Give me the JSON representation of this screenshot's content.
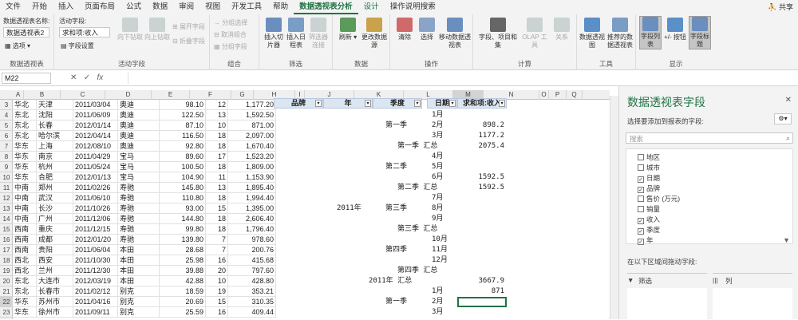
{
  "tabs": [
    "文件",
    "开始",
    "插入",
    "页面布局",
    "公式",
    "数据",
    "审阅",
    "视图",
    "开发工具",
    "帮助",
    "数据透视表分析",
    "设计"
  ],
  "tell_me": "操作说明搜索",
  "share": "共享",
  "ribbon": {
    "pivot_name_label": "数据透视表名称:",
    "pivot_name": "数据透视表2",
    "options": "选项",
    "active_field_label": "活动字段:",
    "active_field": "求和项:收入",
    "field_settings": "字段设置",
    "drill_down": "向下钻取",
    "drill_up": "向上钻取",
    "expand": "展开字段",
    "collapse": "折叠字段",
    "group_sel": "分组选择",
    "ungroup": "取消组合",
    "group_field": "分组字段",
    "insert_slicer": "插入切片器",
    "insert_timeline": "插入日程表",
    "filter_conn": "筛选器连接",
    "refresh": "刷新",
    "change_source": "更改数据源",
    "clear": "清除",
    "select": "选择",
    "move": "移动数据透视表",
    "fields_items": "字段、项目和集",
    "olap": "OLAP 工具",
    "relationships": "关系",
    "pivot_chart": "数据透视图",
    "recommended": "推荐的数据透视表",
    "field_list": "字段列表",
    "pm_buttons": "+/- 按钮",
    "field_headers": "字段标题",
    "groups": [
      "数据透视表",
      "活动字段",
      "组合",
      "筛选",
      "数据",
      "操作",
      "计算",
      "工具",
      "显示"
    ]
  },
  "name_box": "M22",
  "fx": "fx",
  "columns": [
    "A",
    "B",
    "C",
    "D",
    "E",
    "F",
    "G",
    "H",
    "I",
    "J",
    "K",
    "L",
    "M",
    "N",
    "O",
    "P",
    "Q"
  ],
  "rows": [
    {
      "n": "3",
      "a": "华北",
      "b": "天津",
      "c": "2011/03/04",
      "d": "奥迪",
      "e": "98.10",
      "f": "12",
      "g": "1,177.20"
    },
    {
      "n": "4",
      "a": "东北",
      "b": "沈阳",
      "c": "2011/06/09",
      "d": "奥迪",
      "e": "122.50",
      "f": "13",
      "g": "1,592.50"
    },
    {
      "n": "5",
      "a": "东北",
      "b": "长春",
      "c": "2012/01/14",
      "d": "奥迪",
      "e": "87.10",
      "f": "10",
      "g": "871.00"
    },
    {
      "n": "6",
      "a": "东北",
      "b": "哈尔滨",
      "c": "2012/04/14",
      "d": "奥迪",
      "e": "116.50",
      "f": "18",
      "g": "2,097.00"
    },
    {
      "n": "7",
      "a": "华东",
      "b": "上海",
      "c": "2012/08/10",
      "d": "奥迪",
      "e": "92.80",
      "f": "18",
      "g": "1,670.40"
    },
    {
      "n": "8",
      "a": "华东",
      "b": "南京",
      "c": "2011/04/29",
      "d": "宝马",
      "e": "89.60",
      "f": "17",
      "g": "1,523.20"
    },
    {
      "n": "9",
      "a": "华东",
      "b": "杭州",
      "c": "2011/05/24",
      "d": "宝马",
      "e": "100.50",
      "f": "18",
      "g": "1,809.00"
    },
    {
      "n": "10",
      "a": "华东",
      "b": "合肥",
      "c": "2012/01/13",
      "d": "宝马",
      "e": "104.90",
      "f": "11",
      "g": "1,153.90"
    },
    {
      "n": "11",
      "a": "中南",
      "b": "郑州",
      "c": "2011/02/26",
      "d": "寿驰",
      "e": "145.80",
      "f": "13",
      "g": "1,895.40"
    },
    {
      "n": "12",
      "a": "中南",
      "b": "武汉",
      "c": "2011/06/10",
      "d": "寿驰",
      "e": "110.80",
      "f": "18",
      "g": "1,994.40"
    },
    {
      "n": "13",
      "a": "中南",
      "b": "长沙",
      "c": "2011/10/26",
      "d": "寿驰",
      "e": "93.00",
      "f": "15",
      "g": "1,395.00"
    },
    {
      "n": "14",
      "a": "中南",
      "b": "广州",
      "c": "2011/12/06",
      "d": "寿驰",
      "e": "144.80",
      "f": "18",
      "g": "2,606.40"
    },
    {
      "n": "15",
      "a": "西南",
      "b": "重庆",
      "c": "2011/12/15",
      "d": "寿驰",
      "e": "99.80",
      "f": "18",
      "g": "1,796.40"
    },
    {
      "n": "16",
      "a": "西南",
      "b": "成都",
      "c": "2012/01/20",
      "d": "寿驰",
      "e": "139.80",
      "f": "7",
      "g": "978.60"
    },
    {
      "n": "17",
      "a": "西南",
      "b": "贵阳",
      "c": "2011/06/04",
      "d": "本田",
      "e": "28.68",
      "f": "7",
      "g": "200.76"
    },
    {
      "n": "18",
      "a": "西北",
      "b": "西安",
      "c": "2011/10/30",
      "d": "本田",
      "e": "25.98",
      "f": "16",
      "g": "415.68"
    },
    {
      "n": "19",
      "a": "西北",
      "b": "兰州",
      "c": "2011/12/30",
      "d": "本田",
      "e": "39.88",
      "f": "20",
      "g": "797.60"
    },
    {
      "n": "20",
      "a": "东北",
      "b": "大连市",
      "c": "2012/03/19",
      "d": "本田",
      "e": "42.88",
      "f": "10",
      "g": "428.80"
    },
    {
      "n": "21",
      "a": "东北",
      "b": "长春市",
      "c": "2011/02/12",
      "d": "别克",
      "e": "18.59",
      "f": "19",
      "g": "353.21"
    },
    {
      "n": "22",
      "a": "华东",
      "b": "苏州市",
      "c": "2011/04/16",
      "d": "别克",
      "e": "20.69",
      "f": "15",
      "g": "310.35"
    },
    {
      "n": "23",
      "a": "华东",
      "b": "徐州市",
      "c": "2011/09/11",
      "d": "别克",
      "e": "25.59",
      "f": "16",
      "g": "409.44"
    }
  ],
  "pivot": {
    "headers": [
      "品牌",
      "年",
      "季度",
      "日期",
      "求和项:收入"
    ],
    "year": "2011年",
    "q1": "第一季",
    "q2": "第二季",
    "q3": "第三季",
    "q4": "第四季",
    "q1_total": "第一季 汇总",
    "q2_total": "第二季 汇总",
    "q3_total": "第三季 汇总",
    "q4_total": "第四季 汇总",
    "year_total": "2011年 汇总",
    "year_total_val": "3667.9",
    "months": [
      "1月",
      "2月",
      "3月",
      "4月",
      "5月",
      "6月",
      "7月",
      "8月",
      "9月",
      "10月",
      "11月",
      "12月"
    ],
    "v2": "898.2",
    "v3": "1177.2",
    "q1t": "2075.4",
    "v6": "1592.5",
    "q2t": "1592.5",
    "m1b": "1月",
    "m2b": "2月",
    "m3b": "3月",
    "v1b": "871",
    "q1b": "第一季"
  },
  "pane": {
    "title": "数据透视表字段",
    "subtitle": "选择要添加到报表的字段:",
    "search_placeholder": "搜索",
    "fields": [
      {
        "label": "地区",
        "checked": false
      },
      {
        "label": "城市",
        "checked": false
      },
      {
        "label": "日期",
        "checked": true
      },
      {
        "label": "品牌",
        "checked": true
      },
      {
        "label": "售价 (万元)",
        "checked": false
      },
      {
        "label": "销量",
        "checked": false
      },
      {
        "label": "收入",
        "checked": true
      },
      {
        "label": "季度",
        "checked": true
      },
      {
        "label": "年",
        "checked": true
      }
    ],
    "drag_label": "在以下区域间拖动字段:",
    "filter_area": "筛选",
    "column_area": "列"
  }
}
